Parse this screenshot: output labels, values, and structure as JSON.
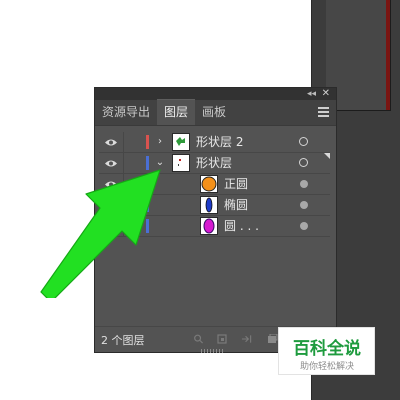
{
  "panel": {
    "tabs": [
      {
        "label": "资源导出",
        "active": false
      },
      {
        "label": "图层",
        "active": true
      },
      {
        "label": "画板",
        "active": false
      }
    ],
    "icons": {
      "collapse": "double-chevron-left-icon",
      "close": "close-icon",
      "menu": "hamburger-menu-icon"
    },
    "layers": [
      {
        "name": "形状层 2",
        "visible": true,
        "color": "#d9534f",
        "expanded": false,
        "thumbnail": "green-shape-on-white",
        "target": "ring"
      },
      {
        "name": "形状层",
        "visible": true,
        "color": "#4a6fd4",
        "expanded": true,
        "thumbnail": "red-dot-on-white",
        "target": "ring",
        "selected_indicator": true
      },
      {
        "name": "正圆",
        "visible": true,
        "color": "",
        "expanded": null,
        "thumbnail": "orange-circle",
        "target": "dot"
      },
      {
        "name": "椭圆",
        "visible": false,
        "color": "#4a6fd4",
        "expanded": null,
        "thumbnail": "blue-ellipse",
        "target": "dot"
      },
      {
        "name": "圆 . . .",
        "visible": false,
        "color": "#4a6fd4",
        "expanded": null,
        "thumbnail": "magenta-ellipse",
        "target": "dot"
      }
    ],
    "footer": {
      "count_label": "2 个图层",
      "icons": [
        "search-icon",
        "sublayer-icon",
        "move-to-layer-icon",
        "new-layer-icon"
      ]
    }
  },
  "annotation": {
    "arrow_color": "#22e022"
  },
  "watermark": {
    "logo": "百科全说",
    "tagline": "助你轻松解决"
  }
}
